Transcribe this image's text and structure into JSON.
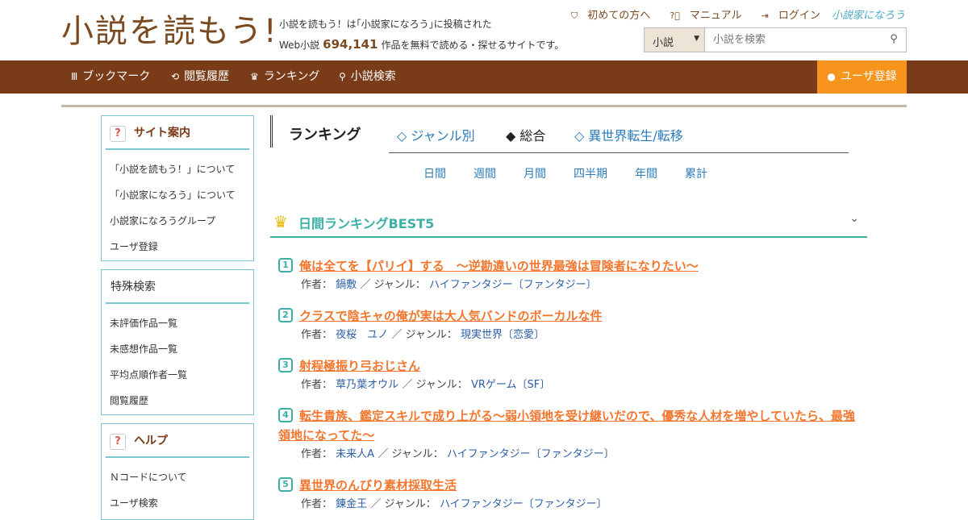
{
  "header": {
    "logo": "小説を読もう!",
    "tagline_line1": "小説を読もう！は｢小説家になろう｣に投稿された",
    "tagline_prefix": "Web小説",
    "novel_count": "694,141",
    "tagline_suffix": "作品を無料で読める・探せるサイトです。",
    "links": {
      "beginner": "初めての方へ",
      "manual": "マニュアル",
      "login": "ログイン",
      "narou": "小説家になろう"
    },
    "search": {
      "select_value": "小説",
      "placeholder": "小説を検索"
    }
  },
  "nav": {
    "bookmark": "ブックマーク",
    "history": "閲覧履歴",
    "ranking": "ランキング",
    "search": "小説検索",
    "register": "ユーザ登録"
  },
  "sidebar": {
    "guide": {
      "title": "サイト案内",
      "items": [
        "「小説を読もう！」について",
        "「小説家になろう」について",
        "小説家になろうグループ",
        "ユーザ登録"
      ]
    },
    "special": {
      "title": "特殊検索",
      "items": [
        "未評価作品一覧",
        "未感想作品一覧",
        "平均点順作者一覧",
        "閲覧履歴"
      ]
    },
    "help": {
      "title": "ヘルプ",
      "items": [
        "Ｎコードについて",
        "ユーザ検索"
      ]
    }
  },
  "ranking": {
    "title": "ランキング",
    "tabs": [
      "◇ ジャンル別",
      "◆ 総合",
      "◇ 異世界転生/転移"
    ],
    "periods": [
      "日間",
      "週間",
      "月間",
      "四半期",
      "年間",
      "累計"
    ],
    "best_title": "日間ランキングBEST5",
    "author_label": "作者：",
    "genre_label": "／ ジャンル：",
    "items": [
      {
        "rank": "1",
        "title": "俺は全てを【パリイ】する　〜逆勘違いの世界最強は冒険者になりたい〜",
        "author": "鍋敷",
        "genre": "ハイファンタジー〔ファンタジー〕"
      },
      {
        "rank": "2",
        "title": "クラスで陰キャの俺が実は大人気バンドのボーカルな件",
        "author": "夜桜　ユノ",
        "genre": "現実世界〔恋愛〕"
      },
      {
        "rank": "3",
        "title": "射程極振り弓おじさん",
        "author": "草乃葉オウル",
        "genre": "VRゲーム〔SF〕"
      },
      {
        "rank": "4",
        "title": "転生貴族、鑑定スキルで成り上がる～弱小領地を受け継いだので、優秀な人材を増やしていたら、最強領地になってた～",
        "author": "未来人A",
        "genre": "ハイファンタジー〔ファンタジー〕"
      },
      {
        "rank": "5",
        "title": "異世界のんびり素材採取生活",
        "author": "錬金王",
        "genre": "ハイファンタジー〔ファンタジー〕"
      }
    ]
  }
}
